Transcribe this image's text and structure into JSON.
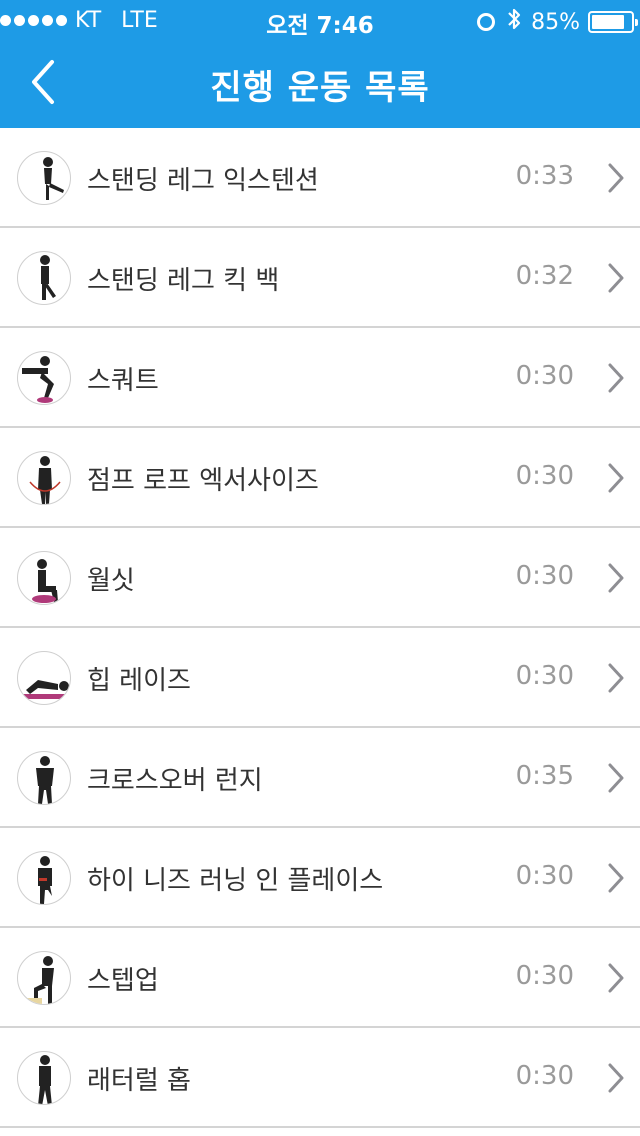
{
  "status_bar": {
    "carrier": "KT",
    "network": "LTE",
    "time": "오전 7:46",
    "battery_text": "85%",
    "battery_level": 0.85
  },
  "nav": {
    "title": "진행 운동 목록",
    "back_icon": "chevron-left-icon"
  },
  "colors": {
    "header_bg": "#1e9be6",
    "divider": "#d4d4d4",
    "time_text": "#9a9a9a"
  },
  "exercises": [
    {
      "name": "스탠딩 레그 익스텐션",
      "time": "0:33",
      "pose": "standing-leg-extension"
    },
    {
      "name": "스탠딩 레그 킥 백",
      "time": "0:32",
      "pose": "standing-leg-kick-back"
    },
    {
      "name": "스쿼트",
      "time": "0:30",
      "pose": "squat"
    },
    {
      "name": "점프 로프 엑서사이즈",
      "time": "0:30",
      "pose": "jump-rope"
    },
    {
      "name": "월싯",
      "time": "0:30",
      "pose": "wall-sit"
    },
    {
      "name": "힙 레이즈",
      "time": "0:30",
      "pose": "hip-raise"
    },
    {
      "name": "크로스오버 런지",
      "time": "0:35",
      "pose": "crossover-lunge"
    },
    {
      "name": "하이 니즈 러닝 인 플레이스",
      "time": "0:30",
      "pose": "high-knees"
    },
    {
      "name": "스텝업",
      "time": "0:30",
      "pose": "step-up"
    },
    {
      "name": "래터럴 홉",
      "time": "0:30",
      "pose": "lateral-hop"
    }
  ]
}
